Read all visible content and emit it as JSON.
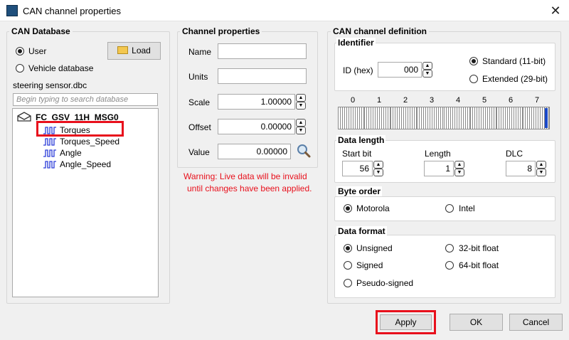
{
  "window": {
    "title": "CAN channel properties",
    "close": "✕"
  },
  "can_database": {
    "title": "CAN Database",
    "user_label": "User",
    "vehicle_label": "Vehicle database",
    "load_label": "Load",
    "db_file": "steering sensor.dbc",
    "search_placeholder": "Begin typing to search database",
    "tree": {
      "message": "FC_GSV_11H_MSG0",
      "signals": [
        "Torques",
        "Torques_Speed",
        "Angle",
        "Angle_Speed"
      ]
    }
  },
  "channel_properties": {
    "title": "Channel properties",
    "name_label": "Name",
    "name_value": "",
    "units_label": "Units",
    "units_value": "",
    "scale_label": "Scale",
    "scale_value": "1.00000",
    "offset_label": "Offset",
    "offset_value": "0.00000",
    "value_label": "Value",
    "value_value": "0.00000",
    "warning_line1": "Warning: Live data will be invalid",
    "warning_line2": "until changes have been applied."
  },
  "can_definition": {
    "title": "CAN channel definition",
    "identifier": {
      "title": "Identifier",
      "id_label": "ID (hex)",
      "id_value": "000",
      "standard_label": "Standard (11-bit)",
      "extended_label": "Extended (29-bit)"
    },
    "bit_numbers": [
      "0",
      "1",
      "2",
      "3",
      "4",
      "5",
      "6",
      "7"
    ],
    "data_length": {
      "title": "Data length",
      "start_bit_label": "Start bit",
      "start_bit_value": "56",
      "length_label": "Length",
      "length_value": "1",
      "dlc_label": "DLC",
      "dlc_value": "8"
    },
    "byte_order": {
      "title": "Byte order",
      "motorola": "Motorola",
      "intel": "Intel"
    },
    "data_format": {
      "title": "Data format",
      "unsigned": "Unsigned",
      "signed": "Signed",
      "pseudo_signed": "Pseudo-signed",
      "float32": "32-bit float",
      "float64": "64-bit float"
    }
  },
  "footer": {
    "apply": "Apply",
    "ok": "OK",
    "cancel": "Cancel"
  },
  "colors": {
    "highlight": "#e8101c",
    "signal_icon": "#2a3bd8",
    "selected_bit": "#1a49c8"
  }
}
